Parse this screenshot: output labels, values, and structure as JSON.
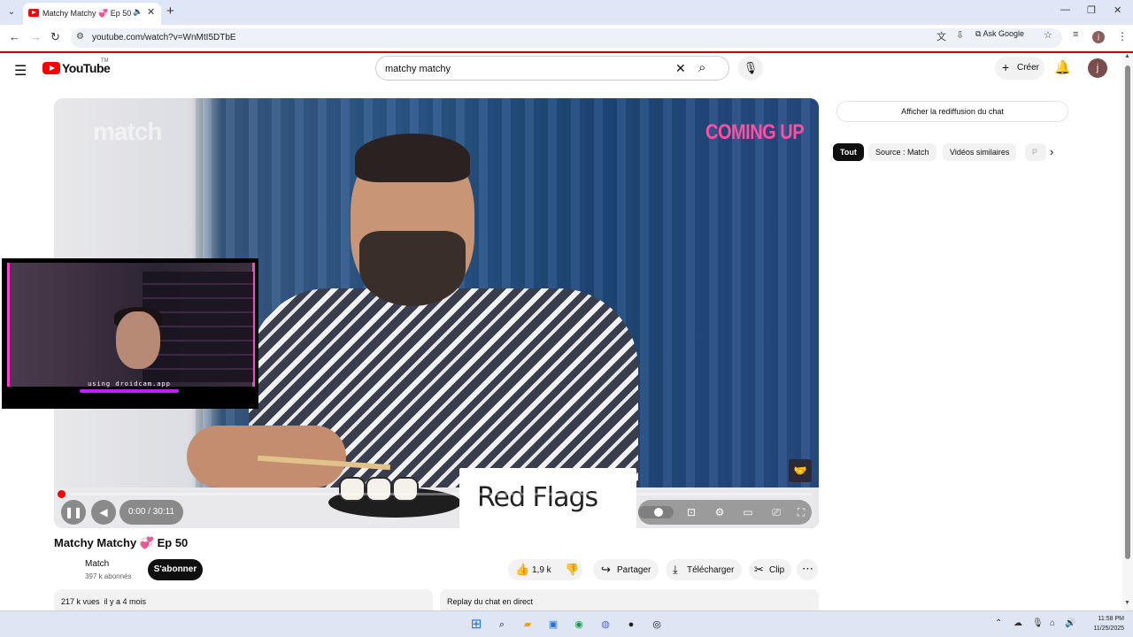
{
  "browser": {
    "tab_title": "Matchy Matchy 💞 Ep 50 -",
    "url": "youtube.com/watch?v=WnMtI5DTbE",
    "ask_google": "Ask Google",
    "profile_initial": "j"
  },
  "masthead": {
    "logo_text": "YouTube",
    "logo_tm": "TM",
    "search_query": "matchy matchy",
    "create_label": "Créer",
    "avatar_initial": "j"
  },
  "player": {
    "brand_overlay": "match",
    "coming_up": "COMING UP",
    "nameplate": "Red Flags",
    "time": "0:00 / 30:11",
    "progress": 0.0,
    "webcam_caption": "using droidcam.app"
  },
  "video": {
    "title": "Matchy Matchy 💞 Ep 50",
    "channel": "Match",
    "subscribers": "397 k abonnés",
    "subscribe_label": "S'abonner",
    "likes": "1,9 k",
    "share_label": "Partager",
    "download_label": "Télécharger",
    "clip_label": "Clip",
    "views_date": "217 k vues  il y a 4 mois",
    "replay_label": "Replay du chat en direct"
  },
  "sidebar": {
    "chat_replay_button": "Afficher la rediffusion du chat",
    "chips": [
      {
        "label": "Tout",
        "active": true
      },
      {
        "label": "Source : Match",
        "active": false
      },
      {
        "label": "Vidéos similaires",
        "active": false
      },
      {
        "label": "P",
        "active": false
      }
    ]
  },
  "taskbar": {
    "time": "11:58 PM",
    "date": "11/25/2025"
  }
}
